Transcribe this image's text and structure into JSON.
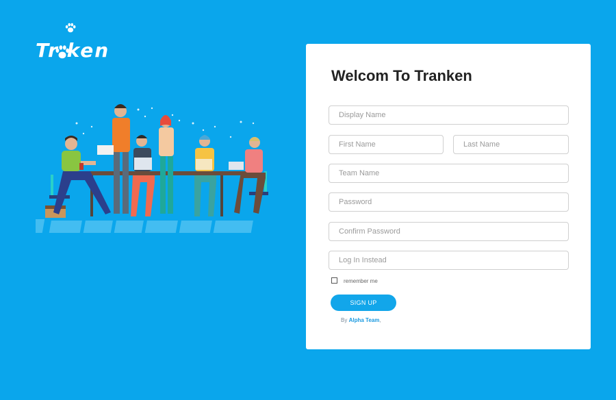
{
  "brand": {
    "name": "Tr ken"
  },
  "form": {
    "title": "Welcom To Tranken",
    "display_name_placeholder": "Display Name",
    "first_name_placeholder": "First Name",
    "last_name_placeholder": "Last Name",
    "team_name_placeholder": "Team Name",
    "password_placeholder": "Password",
    "confirm_password_placeholder": "Confirm Password",
    "login_placeholder": "Log In Instead",
    "remember_label": "remember me",
    "signup_label": "SIGN UP",
    "credit_prefix": "By",
    "credit_team": "Alpha Team",
    "credit_suffix": ","
  },
  "colors": {
    "background": "#0aa6ec",
    "card": "#ffffff",
    "accent": "#12a6ea",
    "link": "#1a9ae0"
  }
}
